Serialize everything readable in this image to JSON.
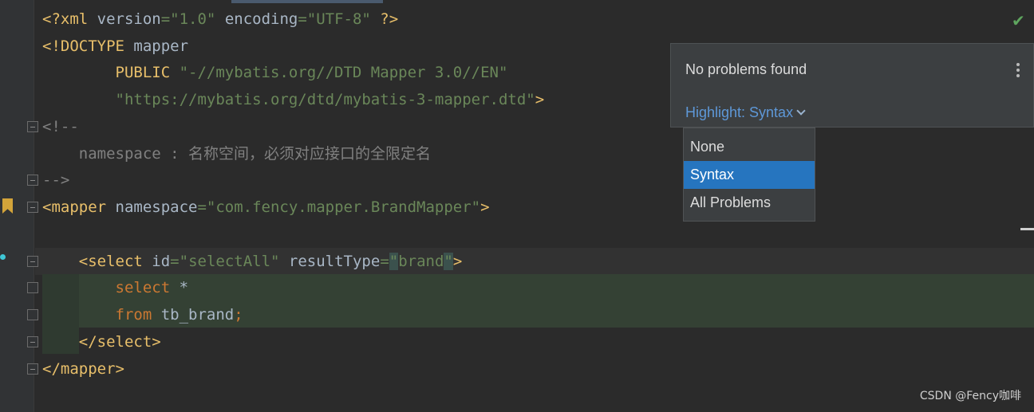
{
  "code": {
    "l1": {
      "a": "<?xml ",
      "b": "version",
      "c": "=",
      "d": "\"1.0\"",
      "e": " encoding",
      "f": "=",
      "g": "\"UTF-8\"",
      "h": " ?>"
    },
    "l2": {
      "a": "<!DOCTYPE ",
      "b": "mapper"
    },
    "l3": {
      "a": "        PUBLIC ",
      "b": "\"-//mybatis.org//DTD Mapper 3.0//EN\""
    },
    "l4": {
      "a": "        \"https://mybatis.org/dtd/mybatis-3-mapper.dtd\"",
      "b": ">"
    },
    "l5": {
      "a": "<!--"
    },
    "l6": {
      "a": "    namespace : 名称空间，必须对应接口的全限定名"
    },
    "l7": {
      "a": "-->"
    },
    "l8": {
      "a": "<mapper ",
      "b": "namespace",
      "c": "=",
      "d": "\"com.fency.mapper.BrandMapper\"",
      "e": ">"
    },
    "l9": {
      "a": ""
    },
    "l10": {
      "a": "    <select ",
      "b": "id",
      "c": "=",
      "d": "\"selectAll\"",
      "e": " resultType",
      "f": "=",
      "g": "\"",
      "h": "brand",
      "i": "\"",
      "j": ">"
    },
    "l11": {
      "a": "        select ",
      "b": "*"
    },
    "l12": {
      "a": "        from ",
      "b": "tb_brand",
      "c": ";"
    },
    "l13": {
      "a": "    </select>"
    },
    "l14": {
      "a": "</mapper>"
    }
  },
  "problems_popup": {
    "title": "No problems found",
    "highlight_label": "Highlight: Syntax",
    "options": [
      "None",
      "Syntax",
      "All Problems"
    ],
    "selected": "Syntax"
  },
  "watermark": "CSDN @Fency咖啡",
  "icons": {
    "check": "check-icon",
    "menu": "more-vertical-icon",
    "bookmark": "bookmark-icon",
    "chevron": "chevron-down-icon"
  },
  "colors": {
    "background": "#2b2b2b",
    "tag": "#e8bf6a",
    "string": "#6a8759",
    "comment": "#808080",
    "keyword": "#cc7832",
    "selected_option": "#2675bf"
  }
}
